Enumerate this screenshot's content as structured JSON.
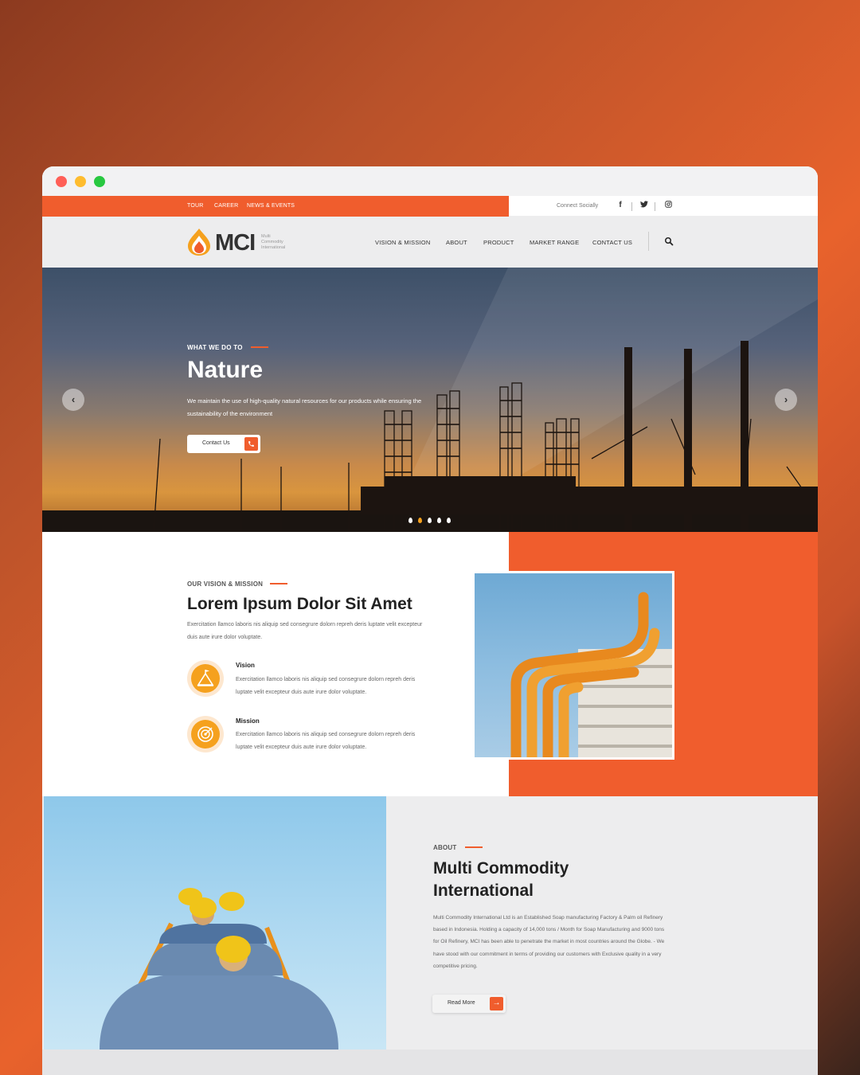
{
  "colors": {
    "accent": "#f05d2d",
    "icon_yellow": "#f5a11e",
    "window_red": "#ff5f57",
    "window_yellow": "#febc2e",
    "window_green": "#28c840"
  },
  "topbar": {
    "links": [
      "TOUR",
      "CAREER",
      "NEWS & EVENTS"
    ],
    "connect_label": "Connect Socially",
    "social": [
      "facebook-icon",
      "twitter-icon",
      "instagram-icon"
    ]
  },
  "header": {
    "logo": {
      "text": "MCI",
      "sub1": "Multi",
      "sub2": "Commodity",
      "sub3": "International"
    },
    "nav": [
      "VISION & MISSION",
      "ABOUT",
      "PRODUCT",
      "MARKET RANGE",
      "CONTACT US"
    ]
  },
  "hero": {
    "label": "WHAT WE DO TO",
    "title": "Nature",
    "text": "We maintain the use of high-quality natural resources for our products while ensuring the sustainability of the environment",
    "button": "Contact Us",
    "slides": 5,
    "active_slide": 2
  },
  "vision": {
    "label": "OUR VISION & MISSION",
    "title": "Lorem Ipsum Dolor Sit Amet",
    "text": "Exercitation llamco laboris nis aliquip sed consegrure dolorn repreh deris luptate velit excepteur duis aute irure dolor voluptate.",
    "items": [
      {
        "title": "Vision",
        "text": "Exercitation llamco laboris nis aliquip sed consegrure dolorn repreh deris luptate velit excepteur duis aute irure dolor voluptate."
      },
      {
        "title": "Mission",
        "text": "Exercitation llamco laboris nis aliquip sed consegrure dolorn repreh deris luptate velit excepteur duis aute irure dolor voluptate."
      }
    ]
  },
  "about": {
    "label": "ABOUT",
    "title_line1": "Multi Commodity",
    "title_line2": "International",
    "text": "Multi Commodity International Ltd is an Established Soap manufacturing Factory & Palm oil Refinery based in Indonesia. Holding a capacity of 14,000 tons / Month for Soap Manufacturing and 9000 tons for Oil Refinery, MCI has been able to penetrate the market in most countries around the Globe. - We have stood with our commitment in terms of providing our customers with Exclusive quality in a very competitive pricing.",
    "button": "Read More"
  }
}
